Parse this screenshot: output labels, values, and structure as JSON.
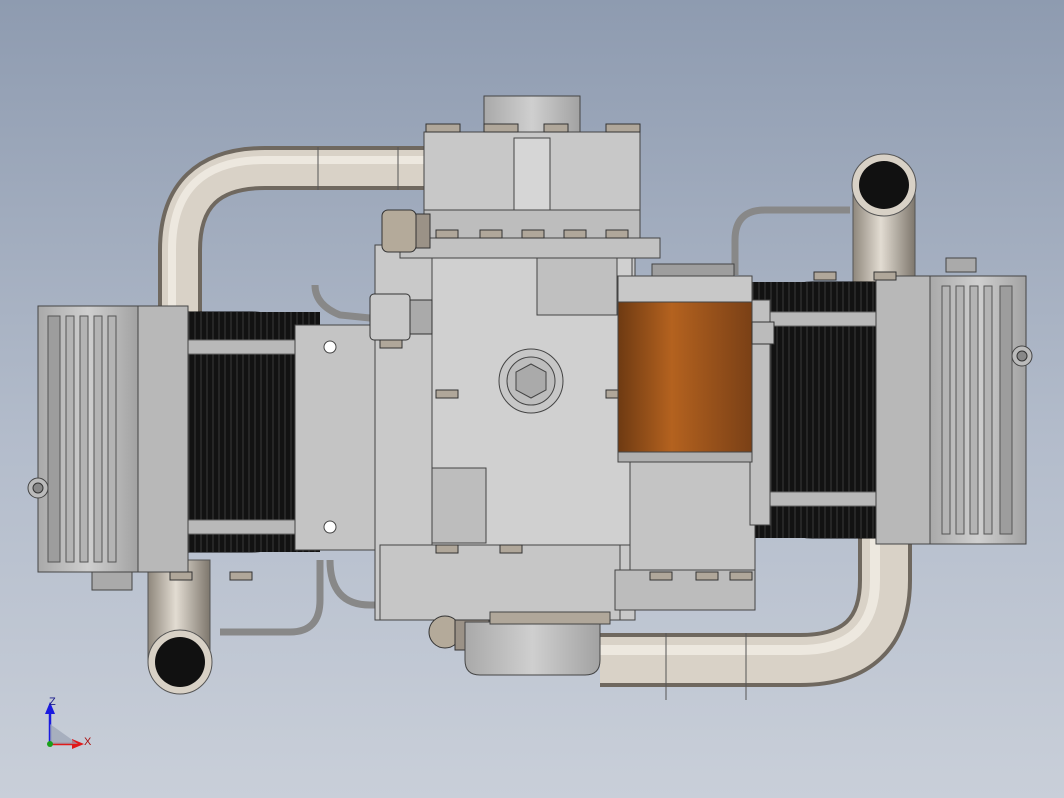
{
  "viewport": {
    "background_top": "#8e9bb0",
    "background_bottom": "#c9cfd9"
  },
  "model": {
    "pipe_color": "#cfc8bd",
    "metal_color": "#c2c2c2",
    "fin_color": "#1a1a1a",
    "filter_color": "#9a5420"
  },
  "triad": {
    "z_label": "Z",
    "x_label": "X",
    "z_color": "#1a1ae0",
    "x_color": "#e01a1a",
    "y_color": "#1aa01a"
  }
}
